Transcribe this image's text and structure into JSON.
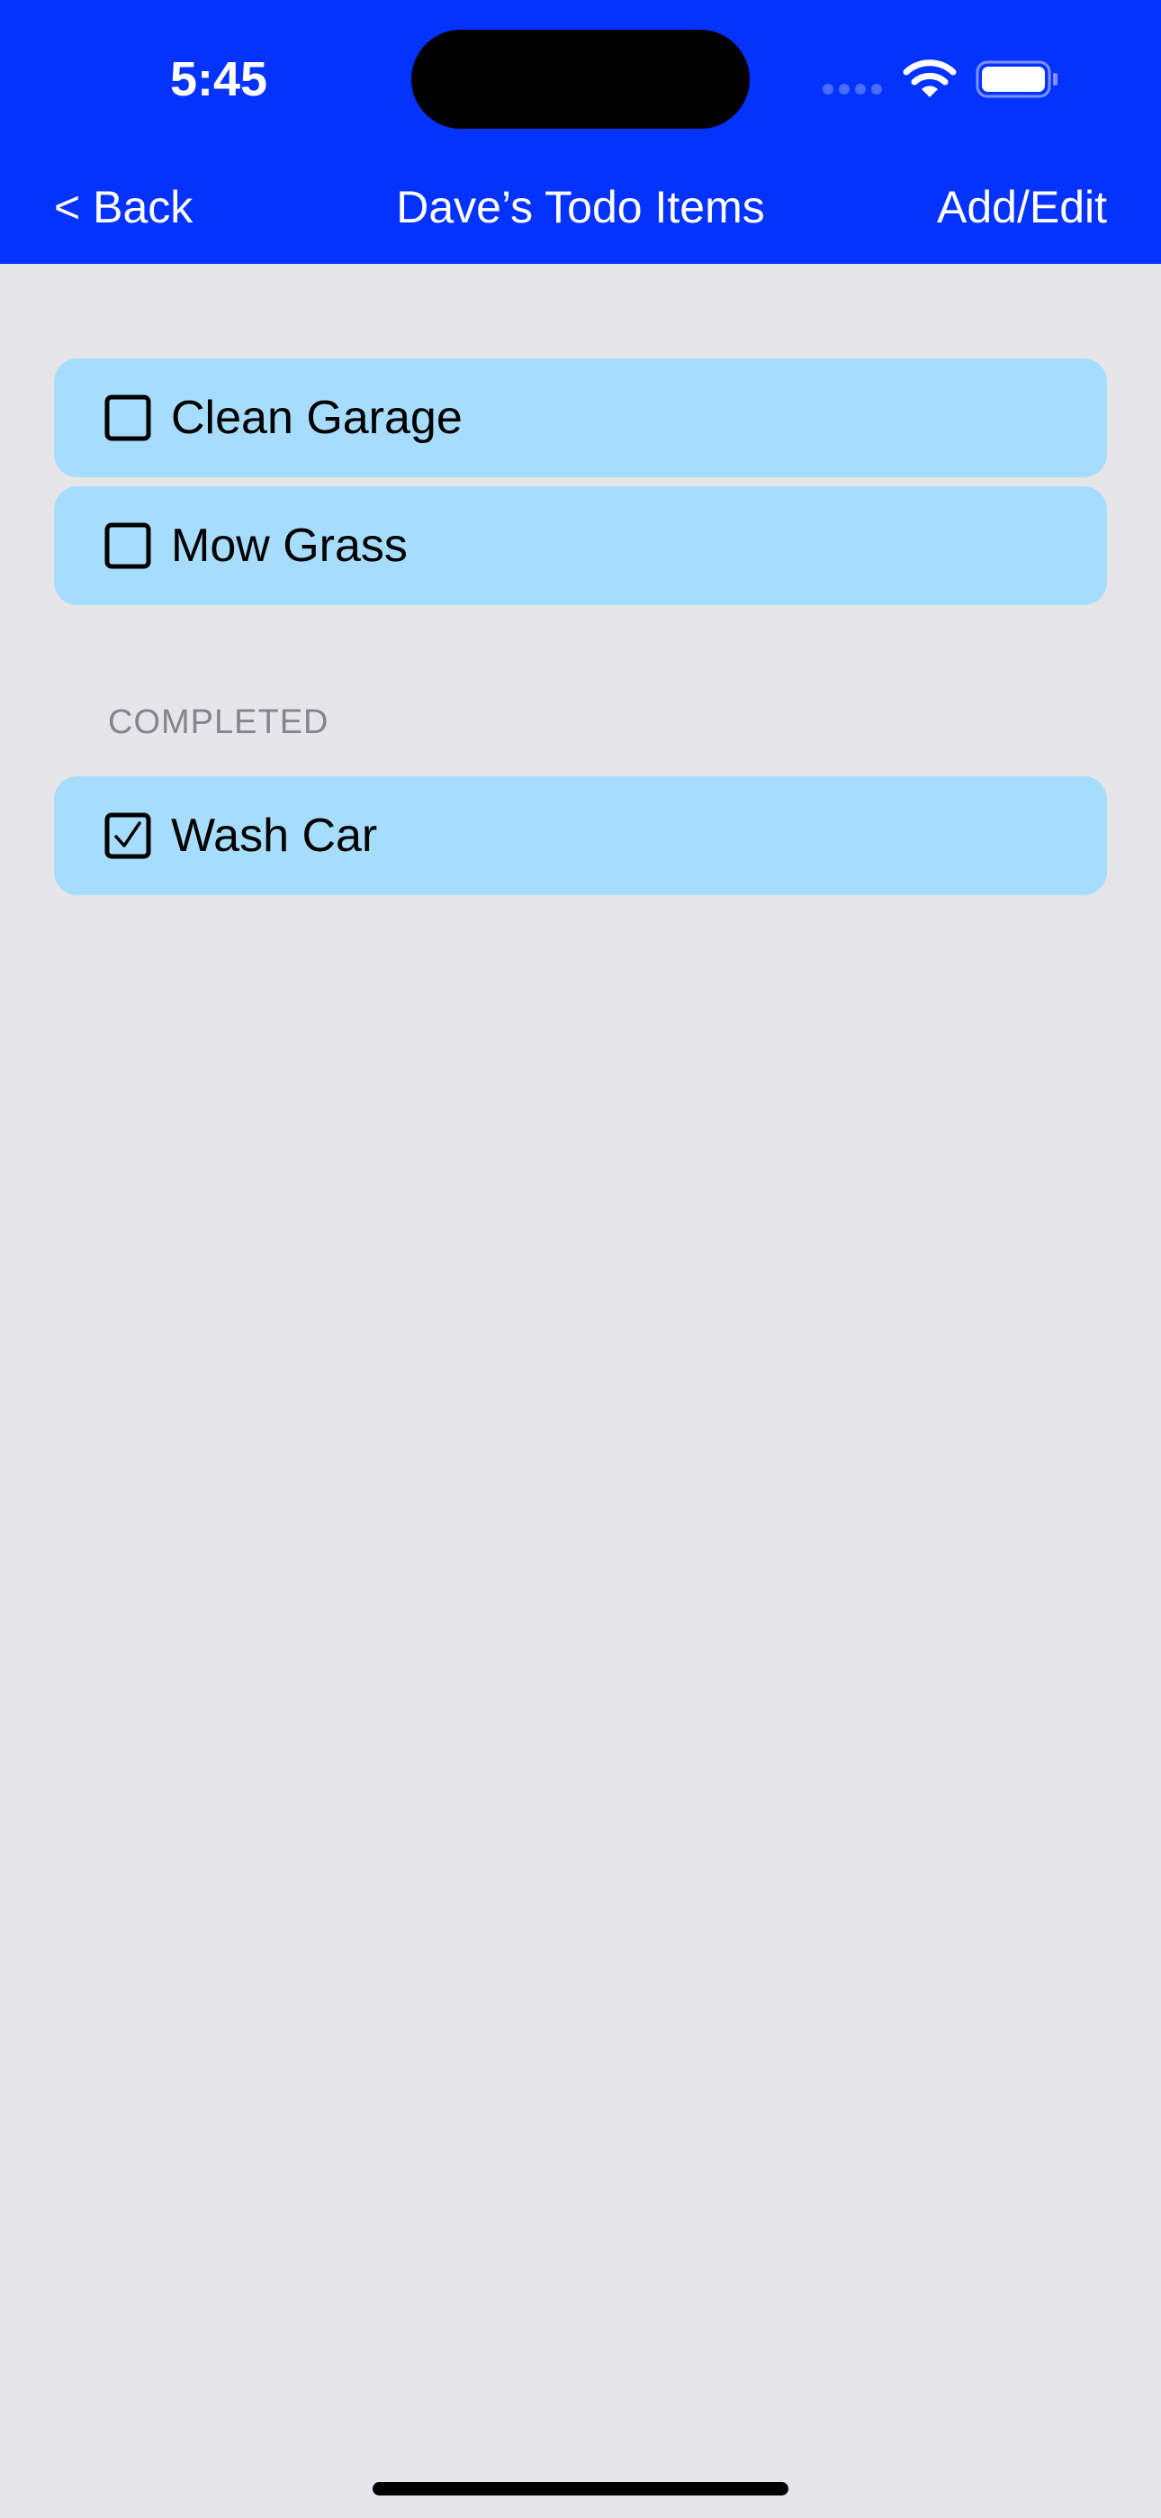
{
  "status_bar": {
    "time": "5:45"
  },
  "nav": {
    "back_label": "< Back",
    "title": "Dave’s Todo Items",
    "add_label": "Add/Edit"
  },
  "todo_items": [
    {
      "label": "Clean Garage",
      "completed": false
    },
    {
      "label": "Mow Grass",
      "completed": false
    }
  ],
  "completed_section": {
    "header": "COMPLETED",
    "items": [
      {
        "label": "Wash Car",
        "completed": true
      }
    ]
  },
  "colors": {
    "header_bg": "#0433ff",
    "row_bg": "#a6dcfc",
    "page_bg": "#e5e5ea"
  }
}
